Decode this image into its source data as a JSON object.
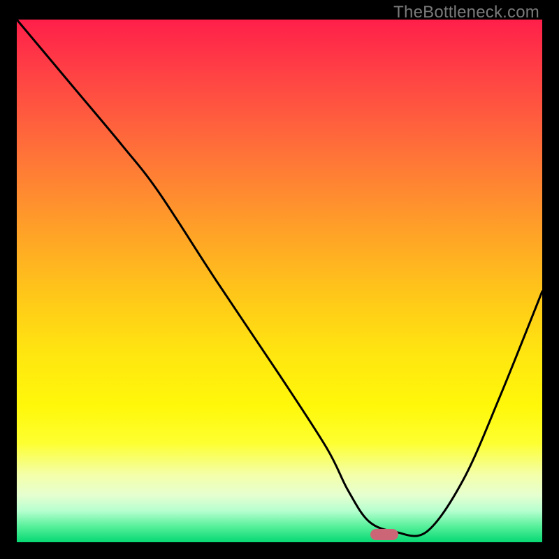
{
  "watermark": "TheBottleneck.com",
  "chart_data": {
    "type": "line",
    "title": "",
    "xlabel": "",
    "ylabel": "",
    "xlim": [
      0,
      100
    ],
    "ylim": [
      0,
      100
    ],
    "grid": false,
    "series": [
      {
        "name": "bottleneck-curve",
        "x": [
          0,
          10,
          20,
          27,
          38,
          50,
          59,
          63,
          67,
          72,
          78,
          85,
          92,
          100
        ],
        "values": [
          100,
          88,
          76,
          67,
          50,
          32,
          18,
          10,
          4,
          2,
          2,
          12,
          28,
          48
        ]
      }
    ],
    "annotations": [
      {
        "name": "optimal-marker",
        "x": 70,
        "y": 1.5,
        "color": "#cc6677"
      }
    ],
    "background_gradient": {
      "top": "#ff1f4a",
      "mid": "#ffd818",
      "bottom": "#06d873"
    }
  }
}
